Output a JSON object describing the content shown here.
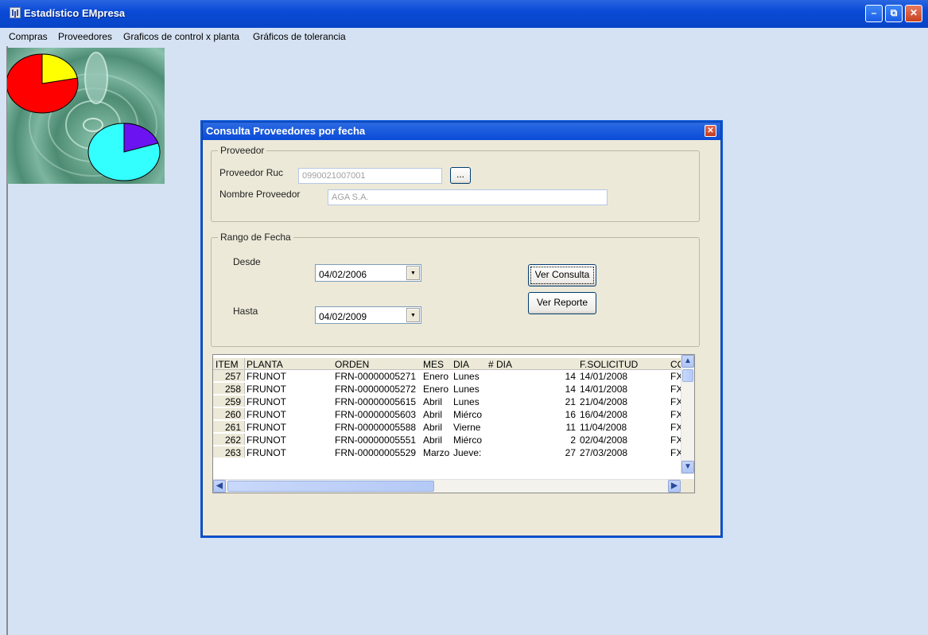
{
  "window": {
    "title": "Estadístico EMpresa",
    "controls": {
      "minimize": "–",
      "restore": "⧉",
      "close": "✕"
    }
  },
  "menu": [
    "Compras",
    "Proveedores",
    "Graficos de control x planta",
    "Gráficos de tolerancia"
  ],
  "splash": {
    "pie_top": {
      "colors": [
        "#ff0000",
        "#ffff00"
      ],
      "highlight_fraction": 0.22
    },
    "pie_bottom": {
      "colors": [
        "#33ffff",
        "#6b13f0"
      ],
      "highlight_fraction": 0.2
    }
  },
  "dialog": {
    "title": "Consulta Proveedores por fecha",
    "close": "✕",
    "proveedor_group": {
      "legend": "Proveedor",
      "ruc_label": "Proveedor Ruc",
      "ruc_value": "0990021007001",
      "browse_button": "...",
      "nombre_label": "Nombre Proveedor",
      "nombre_value": "AGA S.A."
    },
    "fecha_group": {
      "legend": "Rango de Fecha",
      "desde_label": "Desde",
      "desde_value": "04/02/2006",
      "hasta_label": "Hasta",
      "hasta_value": "04/02/2009",
      "ver_consulta": "Ver Consulta",
      "ver_reporte": "Ver Reporte"
    },
    "grid": {
      "columns": [
        "ITEM",
        "PLANTA",
        "ORDEN",
        "MES",
        "DIA",
        "# DIA",
        "F.SOLICITUD",
        "CO"
      ],
      "rows": [
        [
          "257",
          "FRUNOT",
          "FRN-00000005271",
          "Enero",
          "Lunes",
          "14",
          "14/01/2008",
          "FX"
        ],
        [
          "258",
          "FRUNOT",
          "FRN-00000005272",
          "Enero",
          "Lunes",
          "14",
          "14/01/2008",
          "FX"
        ],
        [
          "259",
          "FRUNOT",
          "FRN-00000005615",
          "Abril",
          "Lunes",
          "21",
          "21/04/2008",
          "FX"
        ],
        [
          "260",
          "FRUNOT",
          "FRN-00000005603",
          "Abril",
          "Miérco",
          "16",
          "16/04/2008",
          "FX"
        ],
        [
          "261",
          "FRUNOT",
          "FRN-00000005588",
          "Abril",
          "Vierne",
          "11",
          "11/04/2008",
          "FX"
        ],
        [
          "262",
          "FRUNOT",
          "FRN-00000005551",
          "Abril",
          "Miérco",
          "2",
          "02/04/2008",
          "FX"
        ],
        [
          "263",
          "FRUNOT",
          "FRN-00000005529",
          "Marzo",
          "Jueve:",
          "27",
          "27/03/2008",
          "FX"
        ]
      ],
      "scroll_up": "▲",
      "scroll_down": "▼",
      "scroll_left": "◀",
      "scroll_right": "▶"
    }
  }
}
